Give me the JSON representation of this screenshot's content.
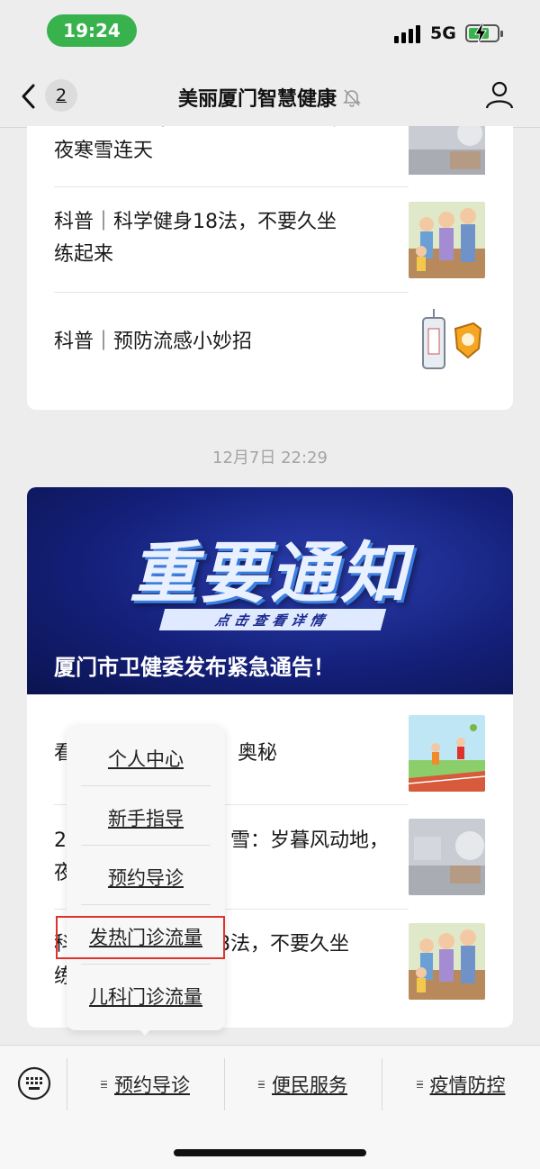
{
  "status_bar": {
    "time": "19:24",
    "network": "5G"
  },
  "header": {
    "back_count": "2",
    "title": "美丽厦门智慧健康"
  },
  "top_card": {
    "articles": [
      {
        "text": "夜寒雪连天",
        "partial_line": "二十四节气｜大雪：岁暮风动地，"
      },
      {
        "line1": "科普｜科学健身18法，不要久坐",
        "line2": "练起来"
      },
      {
        "line1": "科普｜预防流感小妙招"
      }
    ]
  },
  "timestamp": "12月7日 22:29",
  "bottom_card": {
    "banner": {
      "headline": "重要通知",
      "tag": "点击查看详情",
      "caption": "厦门市卫健委发布紧急通告！"
    },
    "articles": [
      {
        "visible_start": "看",
        "visible_end": "奥秘"
      },
      {
        "visible_start": "2",
        "visible_end": "雪：岁暮风动地，",
        "line2_start": "夜"
      },
      {
        "visible_start": "科",
        "visible_end": "8法，不要久坐",
        "line2_start": "练"
      }
    ]
  },
  "popup_menu": {
    "items": [
      "个人中心",
      "新手指导",
      "预约导诊",
      "发热门诊流量",
      "儿科门诊流量"
    ],
    "highlighted_index": 3,
    "highlight_color": "#e0322d"
  },
  "bottom_menu": {
    "items": [
      "预约导诊",
      "便民服务",
      "疫情防控"
    ]
  },
  "colors": {
    "time_pill": "#37b24d",
    "banner_dark": "#14207a"
  }
}
